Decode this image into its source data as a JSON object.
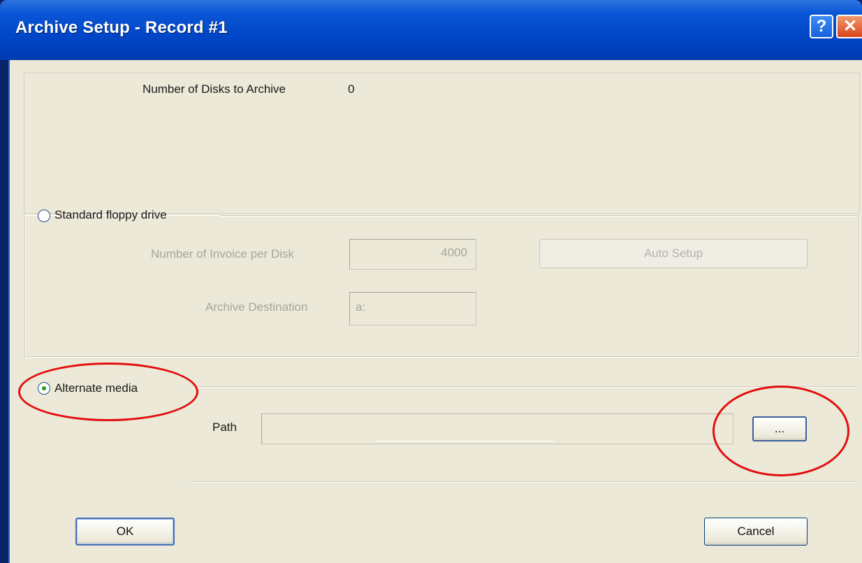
{
  "window": {
    "title": "Archive Setup - Record #1",
    "help_glyph": "?",
    "close_glyph": "✕"
  },
  "summary": {
    "disks_label": "Number of Disks to Archive",
    "disks_value": "0"
  },
  "floppy": {
    "option_label": "Standard floppy drive",
    "selected": false,
    "invoices_label": "Number of Invoice per Disk",
    "invoices_value": "4000",
    "auto_setup_label": "Auto Setup",
    "destination_label": "Archive Destination",
    "destination_value": "a:"
  },
  "alternate": {
    "option_label": "Alternate media",
    "selected": true,
    "path_label": "Path",
    "path_value": "",
    "browse_label": "..."
  },
  "footer": {
    "ok_label": "OK",
    "cancel_label": "Cancel"
  },
  "annotation_color": "#e30d0d"
}
